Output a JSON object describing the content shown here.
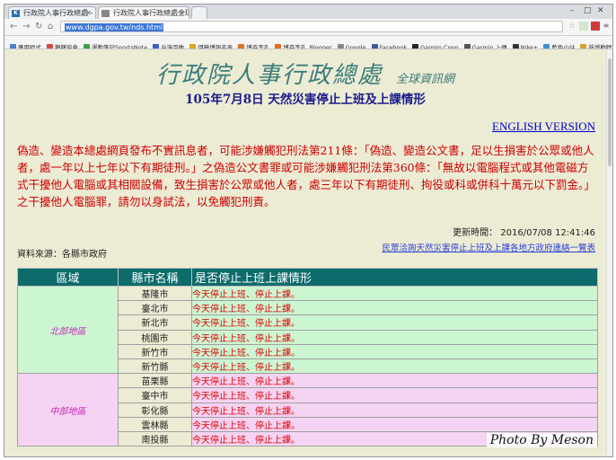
{
  "browser": {
    "tabs": [
      {
        "label": "行政院人事行政總處 - 天..."
      },
      {
        "label": "行政院人事行政總處全球..."
      }
    ],
    "url": "www.dgpa.gov.tw/nds.html",
    "bookmarks": [
      {
        "label": "應用程式",
        "color": "#4a7fd0"
      },
      {
        "label": "鵝鵝協會",
        "color": "#d04a4a"
      },
      {
        "label": "運動筆記SportsNote",
        "color": "#3aa04a"
      },
      {
        "label": "台灣百敗",
        "color": "#3a60c0"
      },
      {
        "label": "伊藤博報名表",
        "color": "#e0a020"
      },
      {
        "label": "博森李孔",
        "color": "#e07020"
      },
      {
        "label": "博森李孔_Blogger",
        "color": "#e07020"
      },
      {
        "label": "Google",
        "color": "#888888"
      },
      {
        "label": "Facebook",
        "color": "#3b5998"
      },
      {
        "label": "Garmin Conn",
        "color": "#222222"
      },
      {
        "label": "Garmin 上傳",
        "color": "#555555"
      },
      {
        "label": "Nike+",
        "color": "#333333"
      },
      {
        "label": "藍色小站",
        "color": "#3a8fd6"
      },
      {
        "label": "新增歡哩",
        "color": "#d6a030"
      }
    ]
  },
  "page": {
    "title": "行政院人事行政總處",
    "title_sub": "全球資訊網",
    "subtitle": "105年7月8日 天然災害停止上班及上課情形",
    "english_link": "ENGLISH VERSION",
    "warning": "偽造、變造本總處網頁發布不實訊息者，可能涉嫌觸犯刑法第211條：「偽造、變造公文書，足以生損害於公眾或他人者，處一年以上七年以下有期徒刑。」之偽造公文書罪或可能涉嫌觸犯刑法第360條：「無故以電腦程式或其他電磁方式干擾他人電腦或其相關設備，致生損害於公眾或他人者，處三年以下有期徒刑、拘役或科或併科十萬元以下罰金。」之干擾他人電腦罪，請勿以身試法，以免觸犯刑責。",
    "updated": "更新時間： 2016/07/08 12:41:46",
    "source": "資料來源：各縣市政府",
    "contact_link": "民眾洽詢天然災害停止上班及上課各地方政府連絡一覽表"
  },
  "table": {
    "headers": [
      "區域",
      "縣市名稱",
      "是否停止上班上課情形"
    ],
    "north_region": "北部地區",
    "north": [
      {
        "city": "基隆市",
        "status": "今天停止上班、停止上課。"
      },
      {
        "city": "臺北市",
        "status": "今天停止上班、停止上課。"
      },
      {
        "city": "新北市",
        "status": "今天停止上班、停止上課。"
      },
      {
        "city": "桃園市",
        "status": "今天停止上班、停止上課。"
      },
      {
        "city": "新竹市",
        "status": "今天停止上班、停止上課。"
      },
      {
        "city": "新竹縣",
        "status": "今天停止上班、停止上課。"
      }
    ],
    "central_region": "中部地區",
    "central": [
      {
        "city": "苗栗縣",
        "status": "今天停止上班、停止上課。"
      },
      {
        "city": "臺中市",
        "status": "今天停止上班、停止上課。"
      },
      {
        "city": "彰化縣",
        "status": "今天停止上班、停止上課。"
      },
      {
        "city": "雲林縣",
        "status": "今天停止上班、停止上課。"
      },
      {
        "city": "南投縣",
        "status": "今天停止上班、停止上課。"
      }
    ]
  },
  "watermark": "Photo By Meson"
}
